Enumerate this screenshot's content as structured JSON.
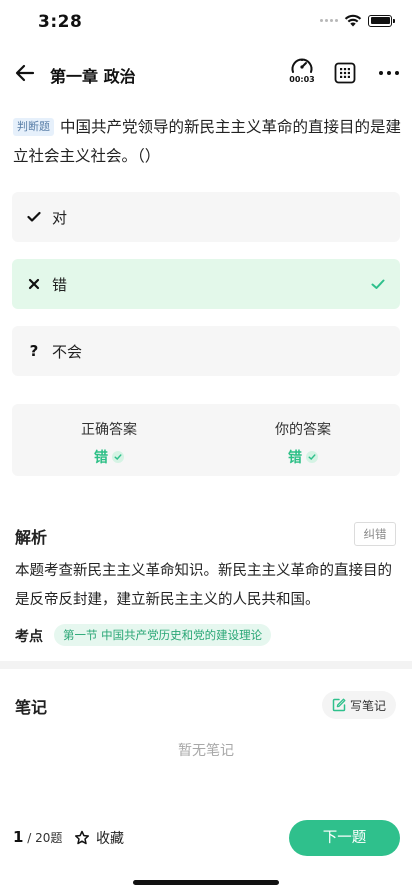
{
  "status_bar": {
    "time": "3:28"
  },
  "nav": {
    "title": "第一章 政治",
    "timer": "00:03"
  },
  "question": {
    "tag": "判断题",
    "text": "中国共产党领导的新民主主义革命的直接目的是建立社会主义社会。（）"
  },
  "options": [
    {
      "mark": "✓",
      "label": "对"
    },
    {
      "mark": "×",
      "label": "错",
      "selected": true
    },
    {
      "mark": "?",
      "label": "不会"
    }
  ],
  "answers": {
    "correct_label": "正确答案",
    "correct_value": "错",
    "yours_label": "你的答案",
    "yours_value": "错"
  },
  "analysis": {
    "title": "解析",
    "report_label": "纠错",
    "text": "本题考查新民主主义革命知识。新民主主义革命的直接目的是反帝反封建，建立新民主主义的人民共和国。",
    "kp_label": "考点",
    "kp_value": "第一节 中国共产党历史和党的建设理论"
  },
  "notes": {
    "title": "笔记",
    "write_label": "写笔记",
    "empty_text": "暂无笔记"
  },
  "bottom": {
    "current": "1",
    "total": " / 20题",
    "favorite_label": "收藏",
    "next_label": "下一题"
  },
  "colors": {
    "accent": "#2fc08c",
    "selected_bg": "#e3f8ea",
    "option_bg": "#f6f6f6"
  }
}
